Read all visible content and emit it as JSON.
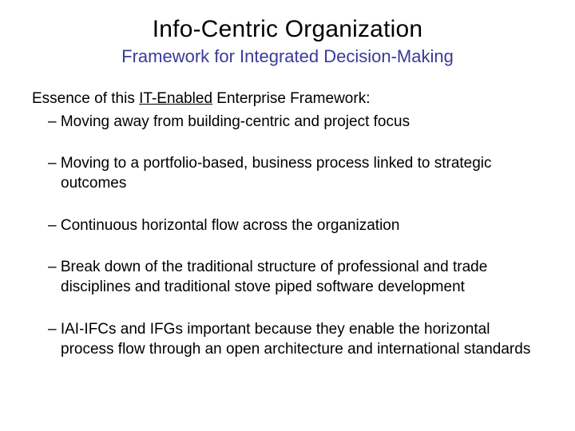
{
  "title": "Info-Centric Organization",
  "subtitle": "Framework for Integrated Decision-Making",
  "lead_pre": "Essence of this ",
  "lead_underlined": "IT-Enabled",
  "lead_post": " Enterprise Framework:",
  "bullets": [
    "Moving away from building-centric and project focus",
    "Moving to a portfolio-based, business process linked to strategic outcomes",
    "Continuous horizontal flow across the organization",
    "Break down of the traditional structure of professional and trade disciplines and traditional stove piped software development",
    "IAI-IFCs and IFGs important because they enable the horizontal process flow through an open architecture and international standards"
  ],
  "dash": "– "
}
